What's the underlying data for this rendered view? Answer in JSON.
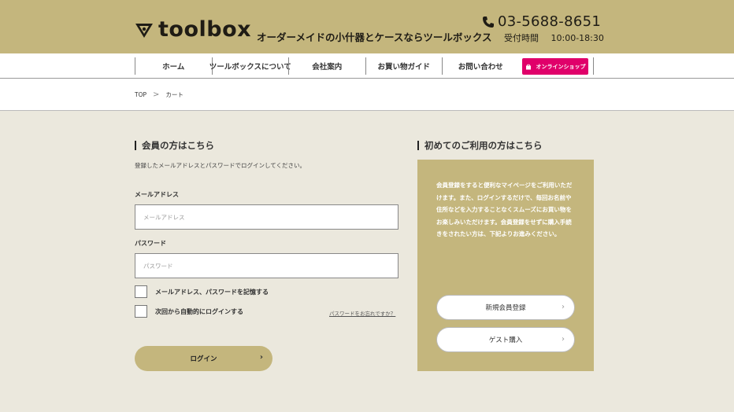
{
  "header": {
    "logo_text": "toolbox",
    "tagline": "オーダーメイドの小什器とケースならツールボックス",
    "phone": "03-5688-8651",
    "hours_label": "受付時間",
    "hours": "10:00-18:30",
    "bg_color": "#c4b67d"
  },
  "nav": {
    "items": [
      {
        "label": "ホーム"
      },
      {
        "label": "ツールボックスについて"
      },
      {
        "label": "会社案内"
      },
      {
        "label": "お買い物ガイド"
      },
      {
        "label": "お問い合わせ"
      }
    ],
    "shop_label": "オンラインショップ",
    "shop_icon": "shopping-bag-icon",
    "shop_color": "#e0006a"
  },
  "breadcrumb": {
    "items": [
      "TOP",
      "カート"
    ],
    "separator": ">"
  },
  "login": {
    "title": "会員の方はこちら",
    "description": "登録したメールアドレスとパスワードでログインしてください。",
    "email_label": "メールアドレス",
    "email_placeholder": "メールアドレス",
    "password_label": "パスワード",
    "password_placeholder": "パスワード",
    "remember_label": "メールアドレス、パスワードを記憶する",
    "auto_login_label": "次回から自動的にログインする",
    "forgot_link": "パスワードをお忘れですか？",
    "submit_label": "ログイン"
  },
  "guest": {
    "title": "初めてのご利用の方はこちら",
    "text": "会員登録をすると便利なマイページをご利用いただけます。また、ログインするだけで、毎回お名前や住所などを入力することなくスムーズにお買い物をお楽しみいただけます。会員登録をせずに購入手続きをされたい方は、下記よりお進みください。",
    "register_label": "新規会員登録",
    "guest_label": "ゲスト購入"
  }
}
